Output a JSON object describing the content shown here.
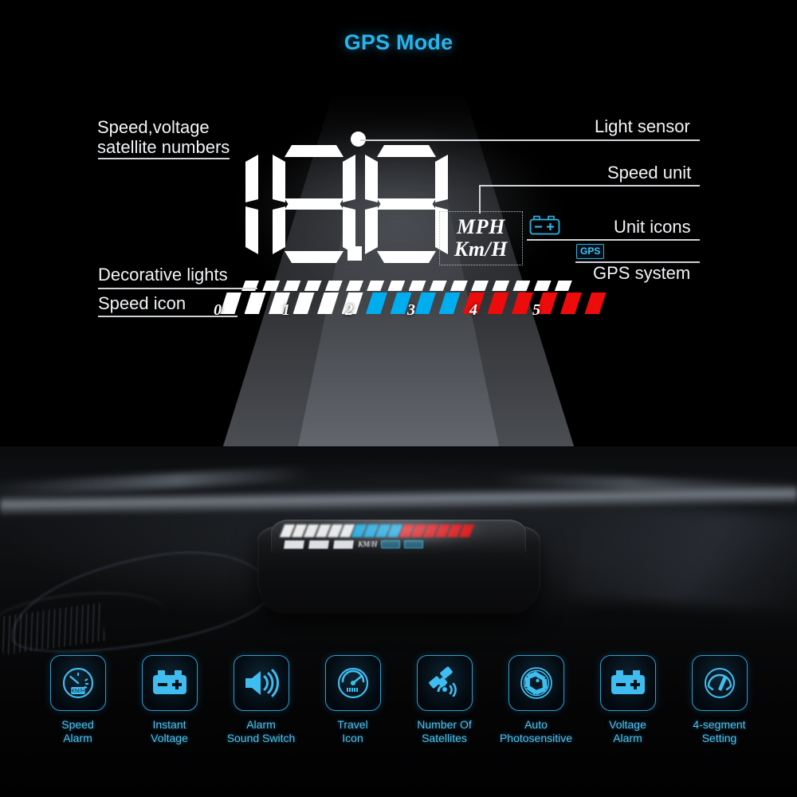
{
  "header": {
    "title": "GPS Mode",
    "accent_color": "#29b4ec"
  },
  "display": {
    "digits": "188",
    "decimal_point": true,
    "light_sensor_dot": true,
    "speed_units": {
      "primary": "MPH",
      "secondary": "Km/H"
    },
    "unit_icons": [
      {
        "name": "battery-icon",
        "symbols": "-+"
      },
      {
        "name": "gps-badge",
        "label": "GPS"
      }
    ]
  },
  "annotations": [
    {
      "id": "speed-voltage-satellite",
      "line1": "Speed,voltage",
      "line2": "satellite numbers",
      "side": "left"
    },
    {
      "id": "decorative-lights",
      "line1": "Decorative lights",
      "side": "left"
    },
    {
      "id": "speed-icon",
      "line1": "Speed icon",
      "side": "left"
    },
    {
      "id": "light-sensor",
      "line1": "Light sensor",
      "side": "right"
    },
    {
      "id": "speed-unit",
      "line1": "Speed unit",
      "side": "right"
    },
    {
      "id": "unit-icons",
      "line1": "Unit icons",
      "side": "right"
    },
    {
      "id": "gps-system",
      "line1": "GPS system",
      "side": "right"
    }
  ],
  "speed_bar": {
    "scale_numbers": [
      "0",
      "1",
      "2",
      "3",
      "4",
      "5"
    ],
    "segment_count": 16,
    "tick_count": 16,
    "colors": {
      "white": "#ffffff",
      "blue": "#00aef0",
      "red": "#ee0b0b"
    },
    "segment_colors": [
      "white",
      "white",
      "white",
      "white",
      "white",
      "white",
      "blue",
      "blue",
      "blue",
      "blue",
      "red",
      "red",
      "red",
      "red",
      "red",
      "red"
    ]
  },
  "features": [
    {
      "icon": "speedometer-icon",
      "line1": "Speed",
      "line2": "Alarm"
    },
    {
      "icon": "battery-icon",
      "line1": "Instant",
      "line2": "Voltage"
    },
    {
      "icon": "speaker-icon",
      "line1": "Alarm",
      "line2": "Sound Switch"
    },
    {
      "icon": "travel-gauge-icon",
      "line1": "Travel",
      "line2": "Icon"
    },
    {
      "icon": "satellite-icon",
      "line1": "Number Of",
      "line2": "Satellites"
    },
    {
      "icon": "aperture-icon",
      "line1": "Auto",
      "line2": "Photosensitive"
    },
    {
      "icon": "battery-alarm-icon",
      "line1": "Voltage",
      "line2": "Alarm"
    },
    {
      "icon": "gauge-needle-icon",
      "line1": "4-segment",
      "line2": "Setting"
    }
  ],
  "device": {
    "name": "hud-device",
    "screen_unit_text": "KM/H"
  }
}
